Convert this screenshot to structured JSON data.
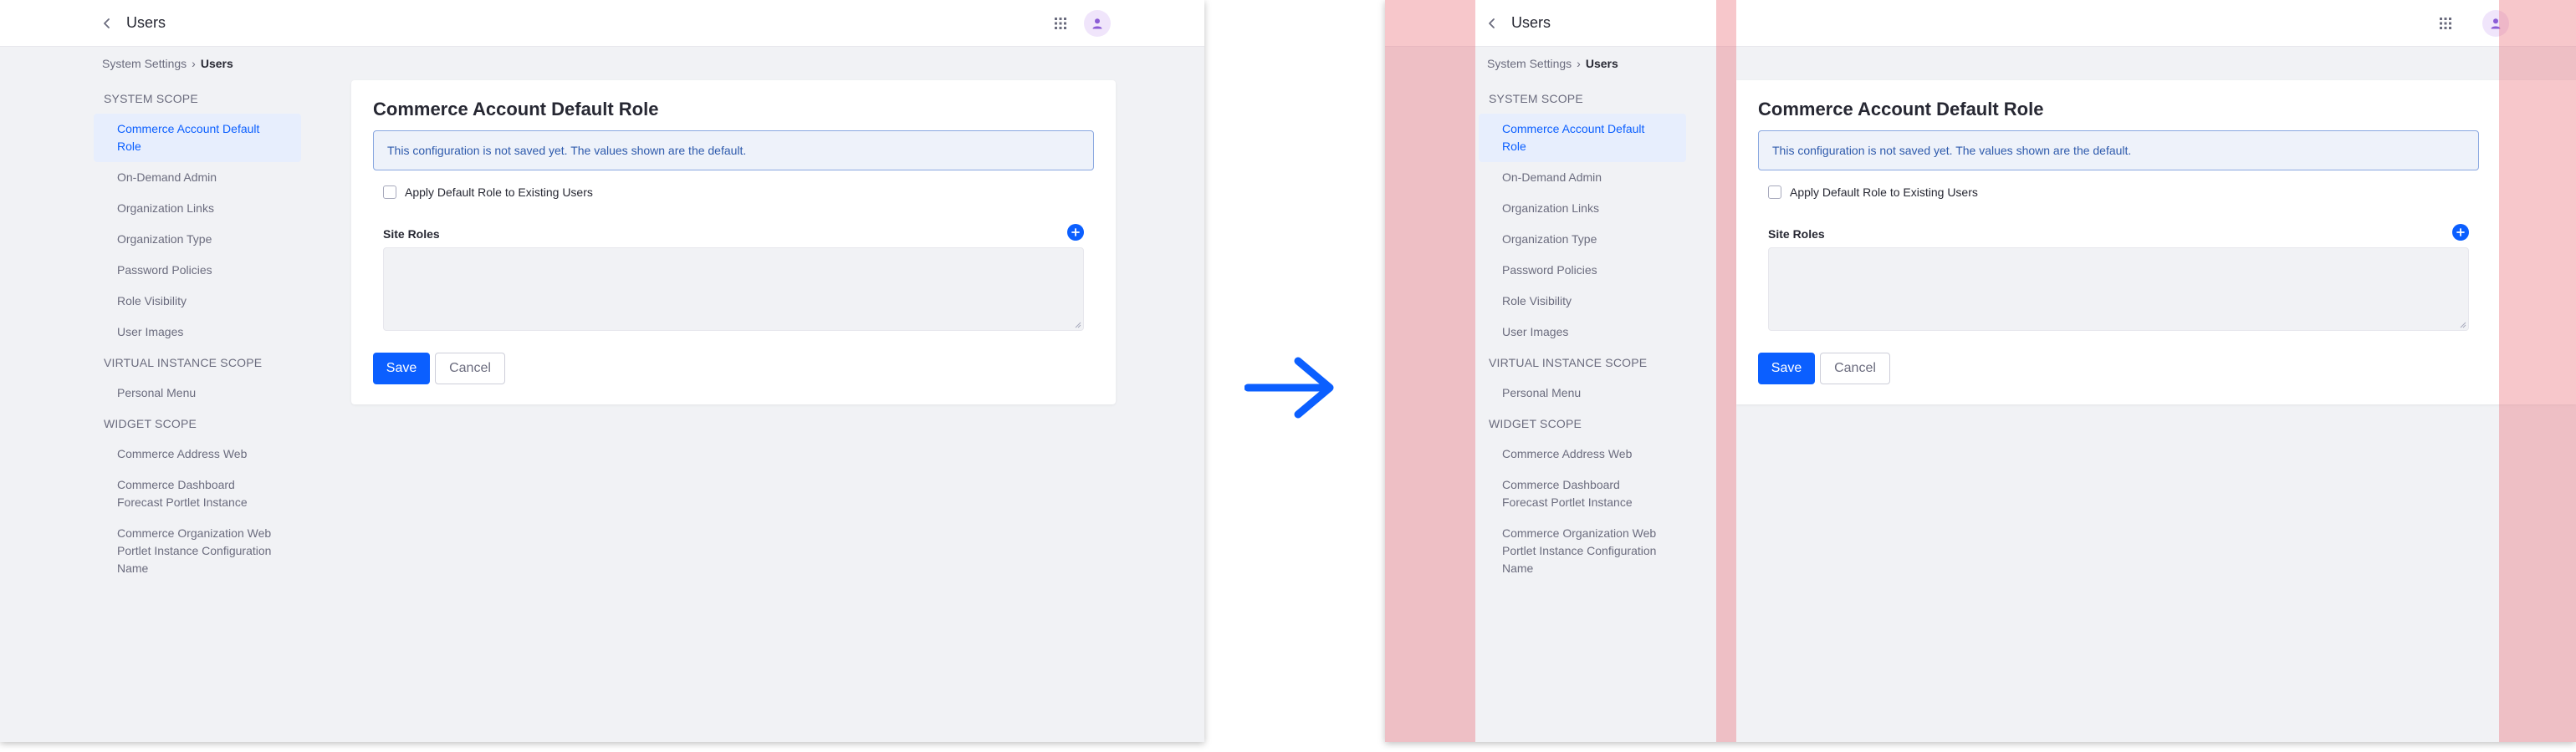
{
  "topbar": {
    "title": "Users"
  },
  "breadcrumb": {
    "parent": "System Settings",
    "separator": "›",
    "current": "Users"
  },
  "sidebar": {
    "sections": [
      {
        "heading": "SYSTEM SCOPE",
        "items": [
          {
            "label": "Commerce Account Default Role",
            "active": true
          },
          {
            "label": "On-Demand Admin"
          },
          {
            "label": "Organization Links"
          },
          {
            "label": "Organization Type"
          },
          {
            "label": "Password Policies"
          },
          {
            "label": "Role Visibility"
          },
          {
            "label": "User Images"
          }
        ]
      },
      {
        "heading": "VIRTUAL INSTANCE SCOPE",
        "items": [
          {
            "label": "Personal Menu"
          }
        ]
      },
      {
        "heading": "WIDGET SCOPE",
        "items": [
          {
            "label": "Commerce Address Web"
          },
          {
            "label": "Commerce Dashboard Forecast Portlet Instance"
          },
          {
            "label": "Commerce Organization Web Portlet Instance Configuration Name"
          }
        ]
      }
    ]
  },
  "form": {
    "title": "Commerce Account Default Role",
    "alert": "This configuration is not saved yet. The values shown are the default.",
    "checkbox_label": "Apply Default Role to Existing Users",
    "site_roles_label": "Site Roles",
    "save_label": "Save",
    "cancel_label": "Cancel"
  },
  "colors": {
    "primary": "#0b5fff",
    "overlay": "#e96c75",
    "alert_bg": "#eef2fa",
    "alert_text": "#2e5aac"
  },
  "icons": {
    "back": "chevron-left-icon",
    "apps": "grid-icon",
    "user": "user-icon",
    "add": "plus-circle-icon",
    "transition": "arrow-right-icon"
  }
}
